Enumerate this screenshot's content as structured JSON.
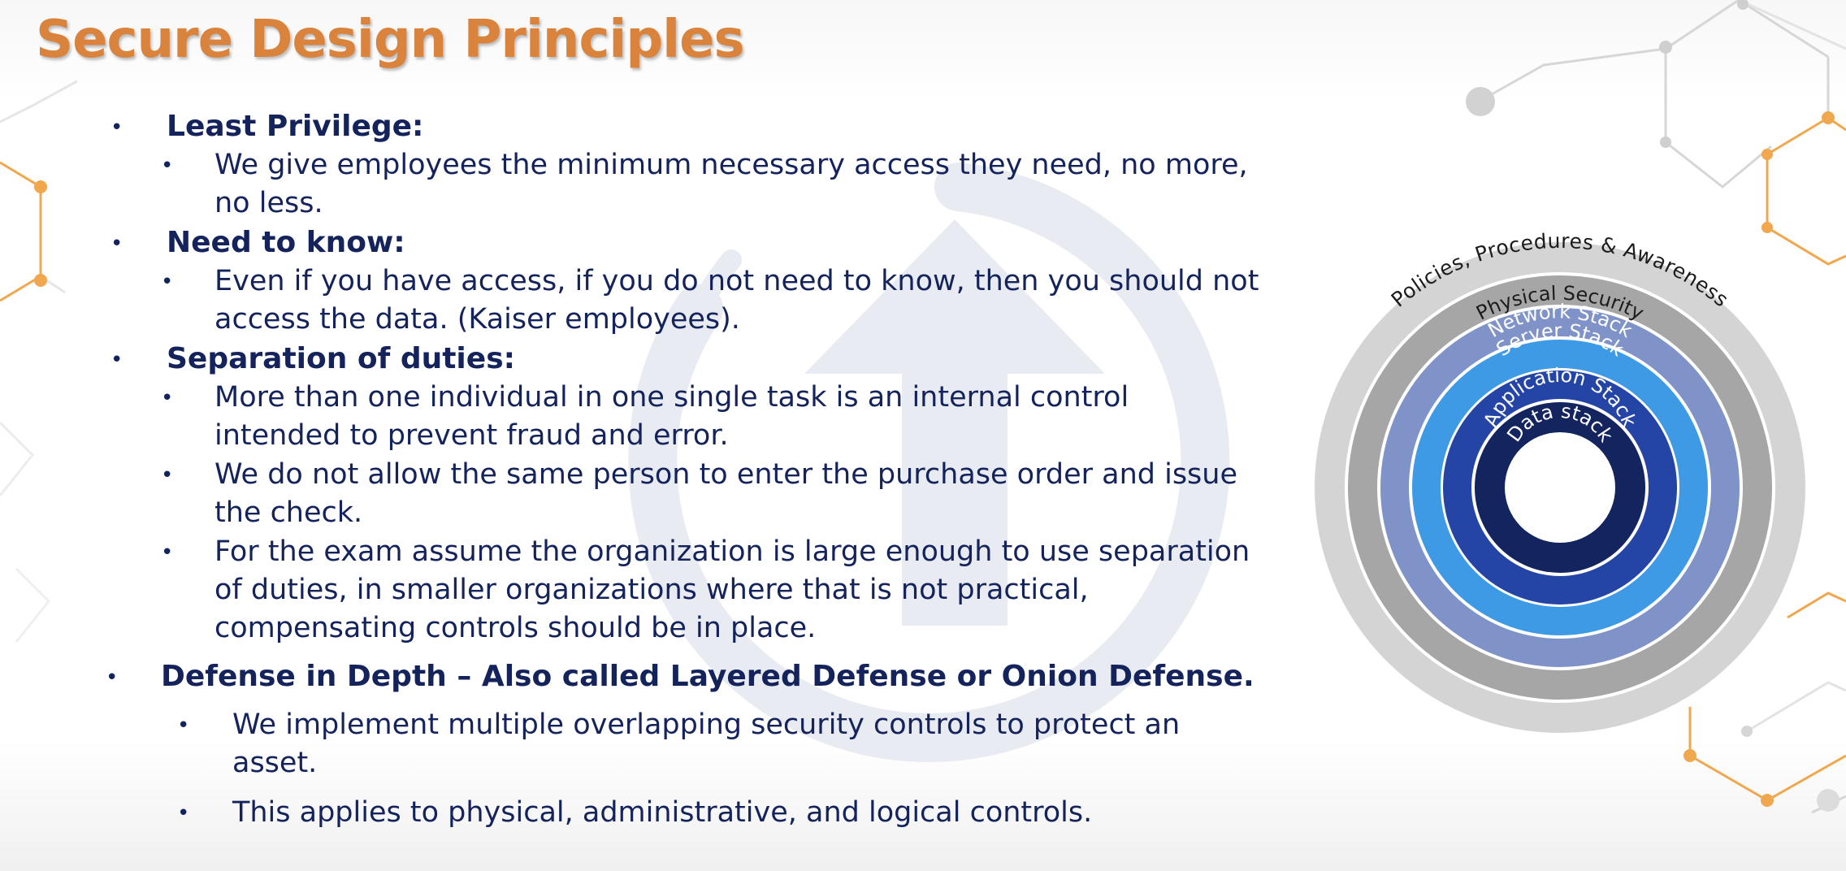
{
  "slide": {
    "title": "Secure Design Principles"
  },
  "bullet_char": "•",
  "sections": {
    "least_privilege": {
      "heading": "Least Privilege:",
      "line1": "We give employees the minimum necessary access they need, no more,",
      "line2": "no less."
    },
    "need_to_know": {
      "heading": "Need to know:",
      "line1": "Even if you have access, if you do not need to know, then you should not",
      "line2": "access the data. (Kaiser employees)."
    },
    "separation": {
      "heading": "Separation of duties:",
      "p1_line1": "More than one individual in one single task is an internal control",
      "p1_line2": "intended to prevent fraud and error.",
      "p2_line1": "We do not allow the same person to enter the purchase order and issue",
      "p2_line2": "the check.",
      "p3_line1": "For the exam assume the organization is large enough to use separation",
      "p3_line2": "of duties, in smaller organizations where that is not practical,",
      "p3_line3": "compensating controls should be in place."
    },
    "defense": {
      "heading": "Defense in Depth – Also called Layered Defense or Onion Defense.",
      "p1_line1": "We implement multiple overlapping security controls to protect an",
      "p1_line2": "asset.",
      "p2_line1": "This applies to physical, administrative, and logical controls."
    }
  },
  "diagram": {
    "layers": [
      {
        "label": "Policies, Procedures & Awareness",
        "color": "#d4d4d4",
        "text_color": "#1c1c1c"
      },
      {
        "label": "Physical Security",
        "color": "#a6a6a6",
        "text_color": "#1c1c1c"
      },
      {
        "label": "Network Stack",
        "color": "#7f93c8",
        "text_color": "#ffffff"
      },
      {
        "label": "Server Stack",
        "color": "#3f9ae6",
        "text_color": "#ffffff"
      },
      {
        "label": "Application Stack",
        "color": "#2545a6",
        "text_color": "#ffffff"
      },
      {
        "label": "Data stack",
        "color": "#13245e",
        "text_color": "#ffffff"
      }
    ]
  },
  "colors": {
    "title": "#d9833d",
    "body_text": "#14235b",
    "watermark": "#e4e8ef",
    "accent_orange": "#f0a74d",
    "network_grey": "#c9c9c9"
  }
}
